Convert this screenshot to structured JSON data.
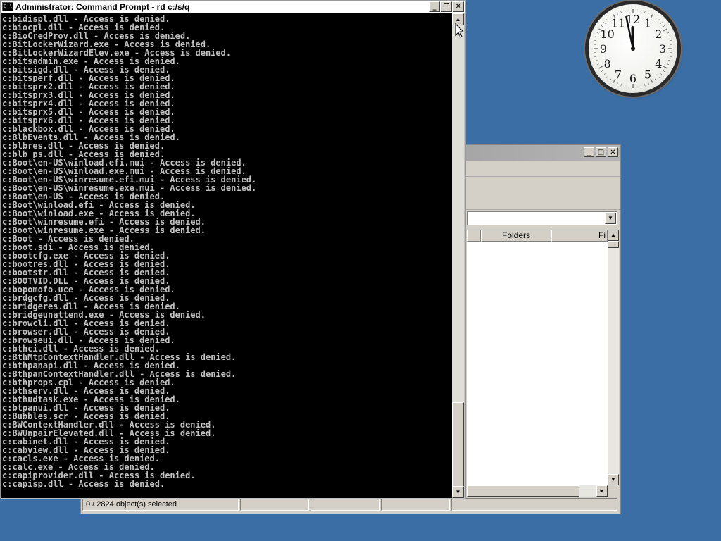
{
  "cmd": {
    "title": "Administrator: Command Prompt - rd  c:/s/q",
    "icon_label": "C:\\",
    "lines": [
      "c:bidispl.dll - Access is denied.",
      "c:biocpl.dll - Access is denied.",
      "c:BioCredProv.dll - Access is denied.",
      "c:BitLockerWizard.exe - Access is denied.",
      "c:BitLockerWizardElev.exe - Access is denied.",
      "c:bitsadmin.exe - Access is denied.",
      "c:bitsigd.dll - Access is denied.",
      "c:bitsperf.dll - Access is denied.",
      "c:bitsprx2.dll - Access is denied.",
      "c:bitsprx3.dll - Access is denied.",
      "c:bitsprx4.dll - Access is denied.",
      "c:bitsprx5.dll - Access is denied.",
      "c:bitsprx6.dll - Access is denied.",
      "c:blackbox.dll - Access is denied.",
      "c:BlbEvents.dll - Access is denied.",
      "c:blbres.dll - Access is denied.",
      "c:blb_ps.dll - Access is denied.",
      "c:Boot\\en-US\\winload.efi.mui - Access is denied.",
      "c:Boot\\en-US\\winload.exe.mui - Access is denied.",
      "c:Boot\\en-US\\winresume.efi.mui - Access is denied.",
      "c:Boot\\en-US\\winresume.exe.mui - Access is denied.",
      "c:Boot\\en-US - Access is denied.",
      "c:Boot\\winload.efi - Access is denied.",
      "c:Boot\\winload.exe - Access is denied.",
      "c:Boot\\winresume.efi - Access is denied.",
      "c:Boot\\winresume.exe - Access is denied.",
      "c:Boot - Access is denied.",
      "c:boot.sdi - Access is denied.",
      "c:bootcfg.exe - Access is denied.",
      "c:bootres.dll - Access is denied.",
      "c:bootstr.dll - Access is denied.",
      "c:BOOTVID.DLL - Access is denied.",
      "c:bopomofo.uce - Access is denied.",
      "c:brdgcfg.dll - Access is denied.",
      "c:bridgeres.dll - Access is denied.",
      "c:bridgeunattend.exe - Access is denied.",
      "c:browcli.dll - Access is denied.",
      "c:browser.dll - Access is denied.",
      "c:browseui.dll - Access is denied.",
      "c:bthci.dll - Access is denied.",
      "c:BthMtpContextHandler.dll - Access is denied.",
      "c:bthpanapi.dll - Access is denied.",
      "c:BthpanContextHandler.dll - Access is denied.",
      "c:bthprops.cpl - Access is denied.",
      "c:bthserv.dll - Access is denied.",
      "c:bthudtask.exe - Access is denied.",
      "c:btpanui.dll - Access is denied.",
      "c:Bubbles.scr - Access is denied.",
      "c:BWContextHandler.dll - Access is denied.",
      "c:BWUnpairElevated.dll - Access is denied.",
      "c:cabinet.dll - Access is denied.",
      "c:cabview.dll - Access is denied.",
      "c:cacls.exe - Access is denied.",
      "c:calc.exe - Access is denied.",
      "c:capiprovider.dll - Access is denied.",
      "c:capisp.dll - Access is denied."
    ]
  },
  "window_buttons": {
    "minimize": "_",
    "maximize": "□",
    "restore": "❐",
    "close": "✕"
  },
  "explorer": {
    "columns": [
      "",
      "Folders",
      "Fi"
    ],
    "status": [
      "0 / 2824 object(s) selected",
      "",
      "",
      "",
      ""
    ]
  },
  "clock": {
    "numerals": [
      "12",
      "1",
      "2",
      "3",
      "4",
      "5",
      "6",
      "7",
      "8",
      "9",
      "10",
      "11"
    ],
    "time": {
      "hour": 11,
      "minute": 58
    }
  },
  "scroll_arrows": {
    "up": "▲",
    "down": "▼",
    "left": "◄",
    "right": "►"
  },
  "colors": {
    "desktop": "#3a6ea5",
    "console_bg": "#000000",
    "console_text": "#c0c0c0"
  }
}
